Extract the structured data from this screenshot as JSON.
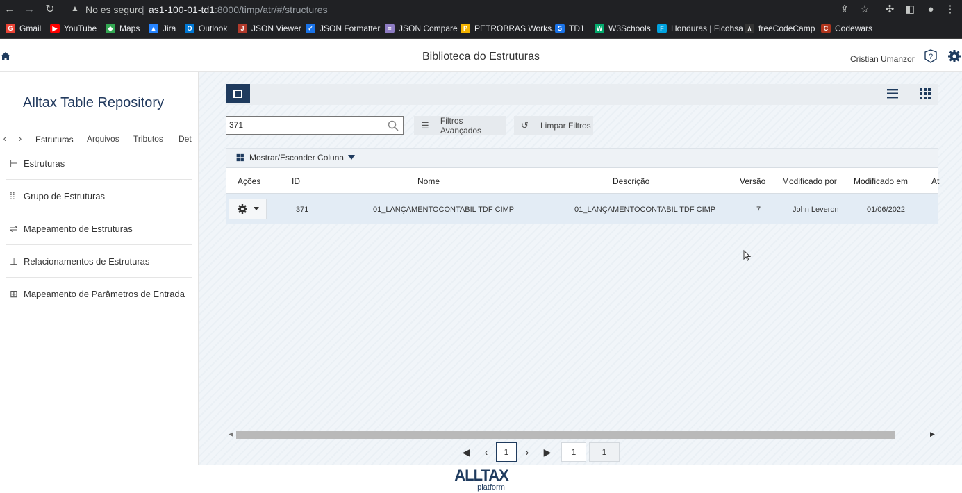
{
  "browser": {
    "warning": "No es seguro",
    "separator": "|",
    "url_host": "as1-100-01-td1",
    "url_rest": ":8000/timp/atr/#/structures",
    "bookmarks": [
      {
        "label": "Gmail",
        "color": "#ea4335",
        "glyph": "G"
      },
      {
        "label": "YouTube",
        "color": "#ff0000",
        "glyph": "▶"
      },
      {
        "label": "Maps",
        "color": "#34a853",
        "glyph": "◆"
      },
      {
        "label": "Jira",
        "color": "#2684ff",
        "glyph": "▲"
      },
      {
        "label": "Outlook",
        "color": "#0078d4",
        "glyph": "O"
      },
      {
        "label": "JSON Viewer",
        "color": "#b23a2c",
        "glyph": "J"
      },
      {
        "label": "JSON Formatter",
        "color": "#1a73e8",
        "glyph": "✓"
      },
      {
        "label": "JSON Compare",
        "color": "#8e7cc3",
        "glyph": "≡"
      },
      {
        "label": "PETROBRAS Works...",
        "color": "#f4b400",
        "glyph": "P"
      },
      {
        "label": "TD1",
        "color": "#1a73e8",
        "glyph": "S"
      },
      {
        "label": "W3Schools",
        "color": "#04aa6d",
        "glyph": "W"
      },
      {
        "label": "Honduras | Ficohsa",
        "color": "#00a3e0",
        "glyph": "F"
      },
      {
        "label": "freeCodeCamp",
        "color": "#333333",
        "glyph": "λ"
      },
      {
        "label": "Codewars",
        "color": "#b1361e",
        "glyph": "C"
      }
    ]
  },
  "header": {
    "title": "Biblioteca do Estruturas",
    "user": "Cristian Umanzor"
  },
  "sidebar": {
    "title": "Alltax Table Repository",
    "tabs": [
      "Estruturas",
      "Arquivos",
      "Tributos",
      "Det"
    ],
    "items": [
      {
        "label": "Estruturas",
        "icon": "structure-icon"
      },
      {
        "label": "Grupo de Estruturas",
        "icon": "group-icon"
      },
      {
        "label": "Mapeamento de Estruturas",
        "icon": "signpost-icon"
      },
      {
        "label": "Relacionamentos de Estruturas",
        "icon": "hierarchy-icon"
      },
      {
        "label": "Mapeamento de Parâmetros de Entrada",
        "icon": "params-icon"
      }
    ]
  },
  "main": {
    "search_value": "371",
    "advanced_filters": "Filtros Avançados",
    "clear_filters": "Limpar Filtros",
    "show_hide_columns": "Mostrar/Esconder Coluna",
    "columns": [
      "Ações",
      "ID",
      "Nome",
      "Descrição",
      "Versão",
      "Modificado por",
      "Modificado em",
      "At"
    ],
    "rows": [
      {
        "id": "371",
        "name": "01_LANÇAMENTOCONTABIL TDF CIMP",
        "description": "01_LANÇAMENTOCONTABIL TDF CIMP",
        "version": "7",
        "modified_by": "John Leveron",
        "modified_at": "01/06/2022"
      }
    ],
    "pagination": {
      "current_page": "1",
      "page_input": "1",
      "total_pages": "1"
    }
  },
  "footer": {
    "logo_main": "ALLTAX",
    "logo_sub": "platform"
  },
  "colors": {
    "brand_dark": "#1f3b5e",
    "row_selected": "#e3ecf5"
  }
}
